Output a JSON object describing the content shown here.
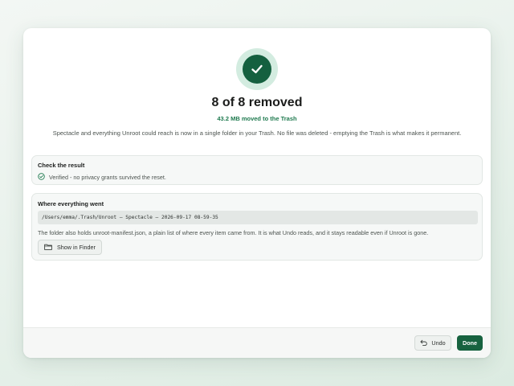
{
  "colors": {
    "accent": "#14603f",
    "accent_light": "#d3ece0",
    "subtitle_green": "#1f7a4f",
    "done_button": "#17623f"
  },
  "header": {
    "icon": "checkmark-icon",
    "title": "8 of 8 removed",
    "subtitle": "43.2 MB moved to the Trash",
    "description": "Spectacle and everything Unroot could reach is now in a single folder in your Trash. No file was deleted - emptying the Trash is what makes it permanent."
  },
  "check_result": {
    "heading": "Check the result",
    "icon": "check-circle-icon",
    "status_text": "Verified - no privacy grants survived the reset."
  },
  "where_went": {
    "heading": "Where everything went",
    "path": "/Users/emma/.Trash/Unroot – Spectacle – 2026-09-17 08-59-35",
    "note": "The folder also holds unroot-manifest.json, a plain list of where every item came from. It is what Undo reads, and it stays readable even if Unroot is gone.",
    "show_button_icon": "folder-icon",
    "show_button_label": "Show in Finder"
  },
  "footer": {
    "undo_icon": "undo-arrow-icon",
    "undo_label": "Undo",
    "done_label": "Done"
  }
}
